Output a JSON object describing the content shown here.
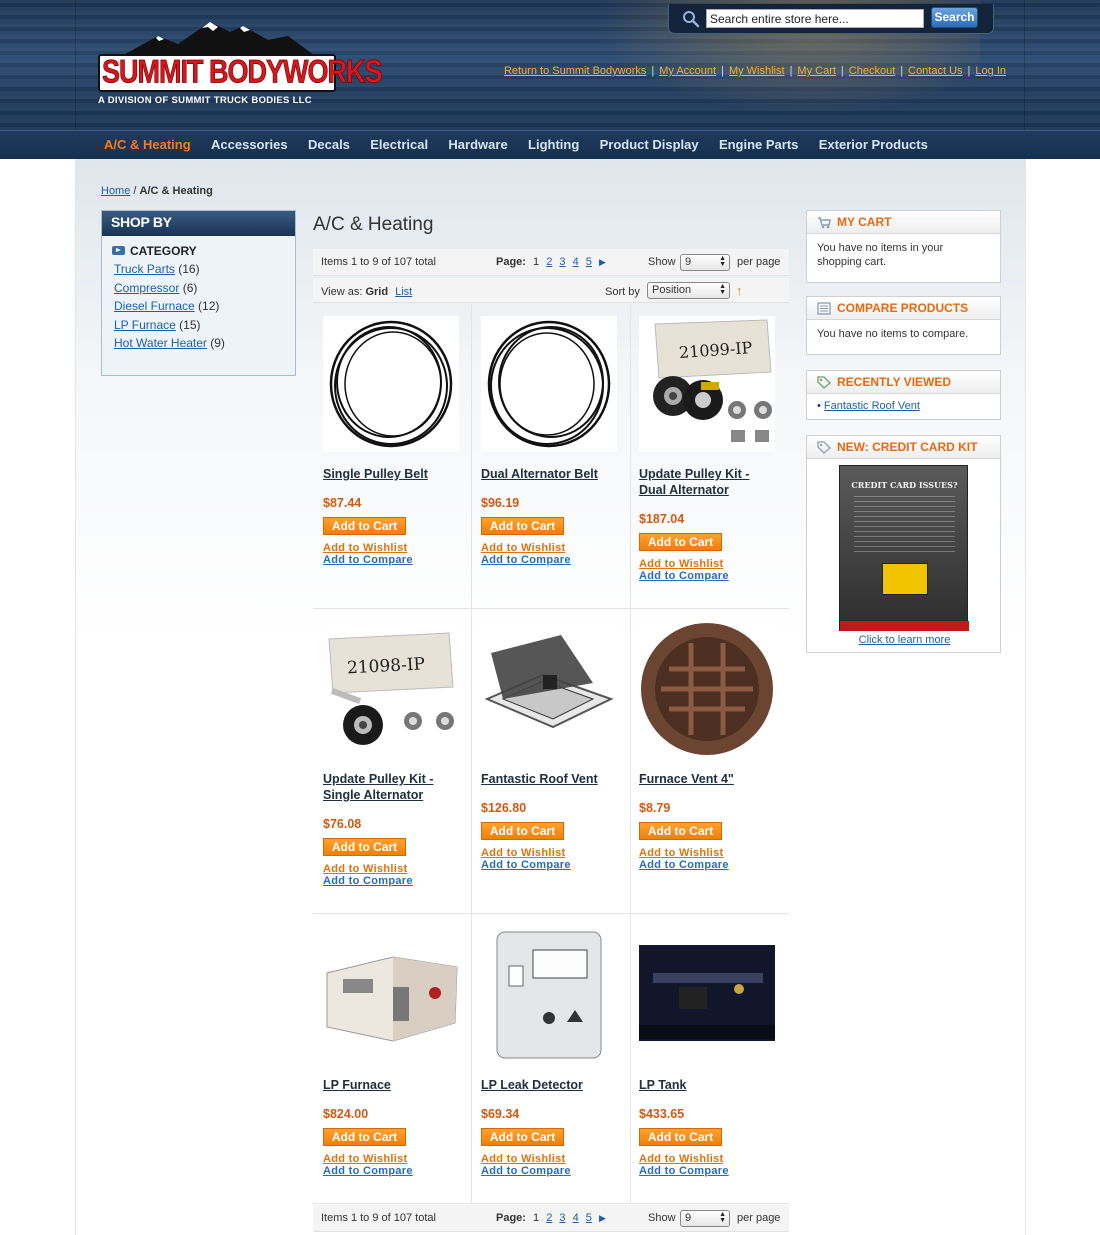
{
  "header": {
    "brand_name": "SUMMIT BODYWORKS",
    "brand_tagline": "A DIVISION OF SUMMIT TRUCK BODIES LLC",
    "search_placeholder": "Search entire store here...",
    "search_button": "Search",
    "top_links": [
      "Return to Summit Bodyworks",
      "My Account",
      "My Wishlist",
      "My Cart",
      "Checkout",
      "Contact Us",
      "Log In"
    ]
  },
  "nav": [
    "A/C & Heating",
    "Accessories",
    "Decals",
    "Electrical",
    "Hardware",
    "Lighting",
    "Product Display",
    "Engine Parts",
    "Exterior Products"
  ],
  "breadcrumb": {
    "home": "Home",
    "sep": "/",
    "current": "A/C & Heating"
  },
  "shop_by": {
    "title": "SHOP BY",
    "category_title": "CATEGORY",
    "items": [
      {
        "label": "Truck Parts",
        "count": "(16)"
      },
      {
        "label": "Compressor",
        "count": "(6)"
      },
      {
        "label": "Diesel Furnace",
        "count": "(12)"
      },
      {
        "label": "LP Furnace",
        "count": "(15)"
      },
      {
        "label": "Hot Water Heater",
        "count": "(9)"
      }
    ]
  },
  "main": {
    "title": "A/C & Heating"
  },
  "toolbar": {
    "amount": "Items 1 to 9 of 107 total",
    "page_label": "Page:",
    "pages": [
      "1",
      "2",
      "3",
      "4",
      "5"
    ],
    "show_label": "Show",
    "show_value": "9",
    "per_page": "per page",
    "view_as_label": "View as:",
    "grid": "Grid",
    "list": "List",
    "sort_label": "Sort by",
    "sort_value": "Position"
  },
  "products": [
    {
      "name": "Single Pulley Belt",
      "price": "$87.44",
      "image": "belt-single"
    },
    {
      "name": "Dual Alternator Belt",
      "price": "$96.19",
      "image": "belt-dual"
    },
    {
      "name": "Update Pulley Kit - Dual Alternator",
      "price": "$187.04",
      "image": "pulley-kit-dual"
    },
    {
      "name": "Update Pulley Kit - Single Alternator",
      "price": "$76.08",
      "image": "pulley-kit-single"
    },
    {
      "name": "Fantastic Roof Vent",
      "price": "$126.80",
      "image": "roof-vent"
    },
    {
      "name": "Furnace Vent 4\"",
      "price": "$8.79",
      "image": "furnace-vent"
    },
    {
      "name": "LP Furnace",
      "price": "$824.00",
      "image": "lp-furnace"
    },
    {
      "name": "LP Leak Detector",
      "price": "$69.34",
      "image": "leak-detector"
    },
    {
      "name": "LP Tank",
      "price": "$433.65",
      "image": "lp-tank"
    }
  ],
  "product_actions": {
    "add_to_cart": "Add to Cart",
    "add_to_wishlist": "Add to Wishlist",
    "add_to_compare": "Add to Compare"
  },
  "sidebar_right": {
    "cart": {
      "title": "MY CART",
      "text": "You have no items in your shopping cart."
    },
    "compare": {
      "title": "COMPARE PRODUCTS",
      "text": "You have no items to compare."
    },
    "recent": {
      "title": "RECENTLY VIEWED",
      "items": [
        "Fantastic Roof Vent"
      ]
    },
    "promo": {
      "title": "NEW: CREDIT CARD KIT",
      "link": "Click to learn more",
      "image_heading": "CREDIT CARD ISSUES?"
    }
  },
  "colors": {
    "accent": "#e46a12",
    "link": "#1e5fa8",
    "nav_bg": "#1f3a5c",
    "price": "#cf5a11"
  }
}
